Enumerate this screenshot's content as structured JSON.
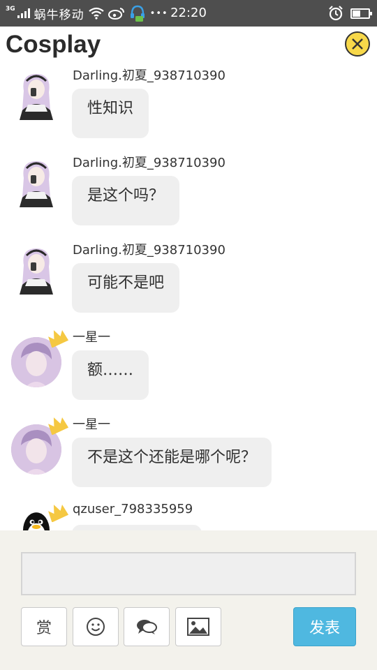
{
  "status_bar": {
    "network": "3G",
    "carrier": "蜗牛移动",
    "more": "•••",
    "time": "22:20"
  },
  "header": {
    "title": "Cosplay"
  },
  "messages": [
    {
      "user": "Darling.初夏_938710390",
      "text": "性知识",
      "avatar": "anime-girl"
    },
    {
      "user": "Darling.初夏_938710390",
      "text": "是这个吗？",
      "avatar": "anime-girl"
    },
    {
      "user": "Darling.初夏_938710390",
      "text": "可能不是吧",
      "avatar": "anime-girl"
    },
    {
      "user": "一星一",
      "text": "额……",
      "avatar": "boy-portrait",
      "crown": true
    },
    {
      "user": "一星一",
      "text": "不是这个还能是哪个呢？",
      "avatar": "boy-portrait",
      "crown": true
    },
    {
      "user": "qzuser_798335959",
      "text": "",
      "avatar": "qq-penguin",
      "crown": true
    }
  ],
  "composer": {
    "input_value": "",
    "reward_label": "赏",
    "emoji_icon": "smiley-icon",
    "chat_icon": "speech-bubbles-icon",
    "image_icon": "image-icon",
    "post_label": "发表"
  },
  "colors": {
    "status_bar": "#4e4e4e",
    "close_button": "#f7d84a",
    "bubble": "#efefef",
    "post_button": "#4fb8e0",
    "bottom_bar": "#f3f2ec"
  }
}
